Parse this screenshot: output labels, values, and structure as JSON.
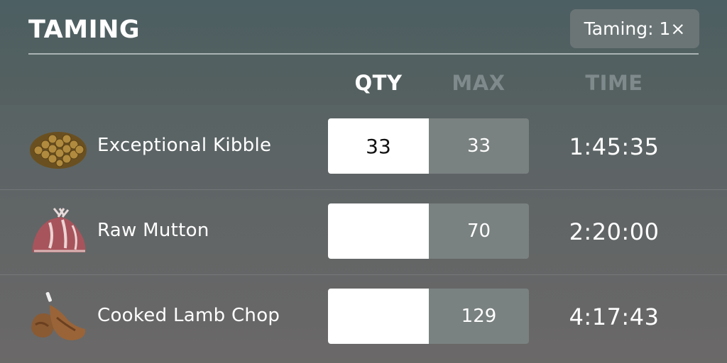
{
  "header": {
    "title": "TAMING",
    "taming_button": "Taming: 1×"
  },
  "columns": {
    "qty": "QTY",
    "max": "MAX",
    "time": "TIME"
  },
  "rows": [
    {
      "name": "Exceptional Kibble",
      "icon": "kibble-icon",
      "qty": "33",
      "max": "33",
      "time": "1:45:35"
    },
    {
      "name": "Raw Mutton",
      "icon": "raw-mutton-icon",
      "qty": "",
      "max": "70",
      "time": "2:20:00"
    },
    {
      "name": "Cooked Lamb Chop",
      "icon": "cooked-lamb-chop-icon",
      "qty": "",
      "max": "129",
      "time": "4:17:43"
    }
  ],
  "colors": {
    "header_bg": "#4c5f62",
    "input_bg": "#ffffff",
    "max_bg": "#7a8181",
    "inactive_header": "#7e8a8b"
  }
}
